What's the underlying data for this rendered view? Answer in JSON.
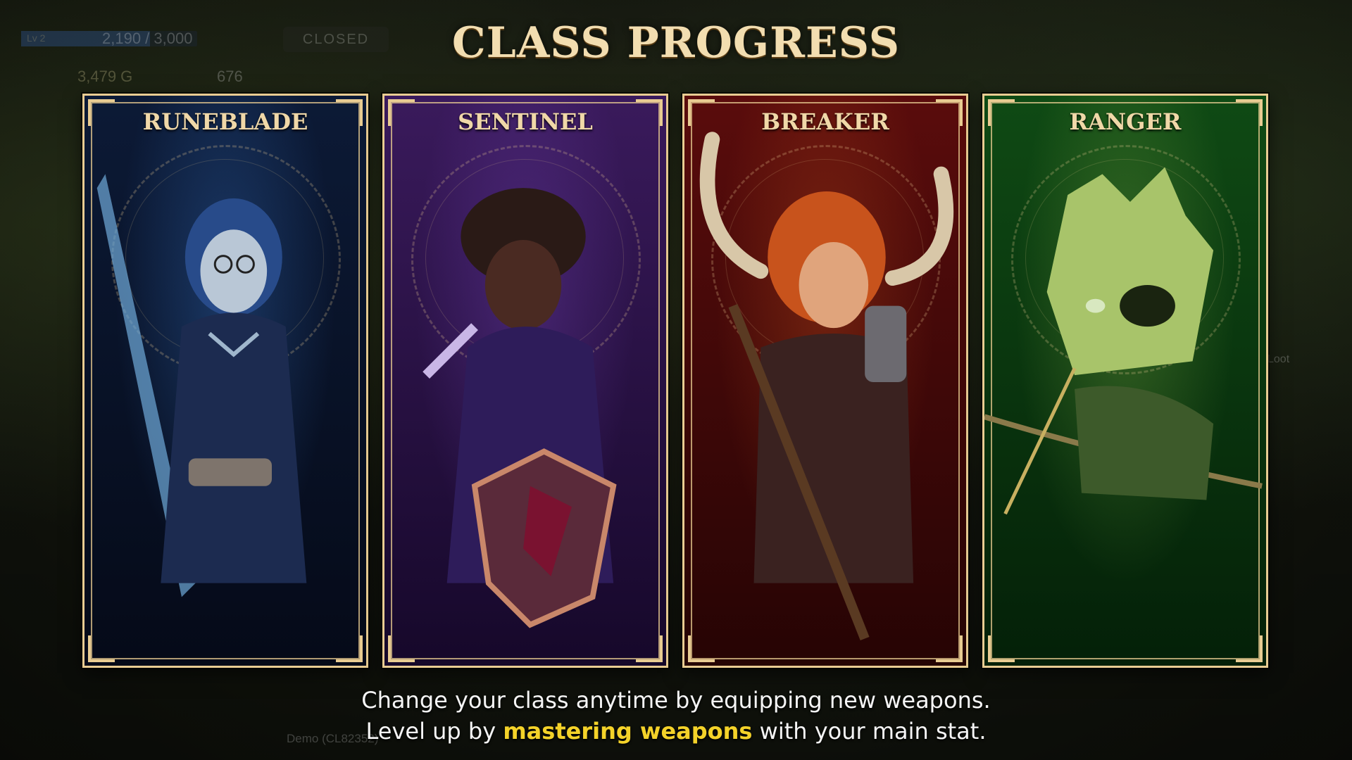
{
  "title": "CLASS PROGRESS",
  "hud": {
    "level_label": "Lv 2",
    "xp_text": "2,190 / 3,000",
    "xp_fraction": 0.73,
    "status_badge": "CLOSED",
    "gold": "3,479 G",
    "gems": "676",
    "build": "Demo (CL82352)",
    "loot_hint": "Loot"
  },
  "classes": [
    {
      "name": "RUNEBLADE",
      "icon": "runeblade-portrait",
      "color_top": "#0c1a36",
      "color_bottom": "#050a18",
      "accent": "#3c7fd8"
    },
    {
      "name": "SENTINEL",
      "icon": "sentinel-portrait",
      "color_top": "#3a1a5c",
      "color_bottom": "#16082a",
      "accent": "#7b49c2"
    },
    {
      "name": "BREAKER",
      "icon": "breaker-portrait",
      "color_top": "#5a0c0c",
      "color_bottom": "#260404",
      "accent": "#c8531c"
    },
    {
      "name": "RANGER",
      "icon": "ranger-portrait",
      "color_top": "#0f4a14",
      "color_bottom": "#042008",
      "accent": "#8ab84a"
    }
  ],
  "caption": {
    "line1": "Change your class anytime by equipping new weapons.",
    "line2_pre": "Level up by ",
    "line2_highlight": "mastering weapons",
    "line2_post": " with your main stat."
  },
  "colors": {
    "frame_gold": "#e9cc92",
    "highlight": "#f4d229"
  }
}
